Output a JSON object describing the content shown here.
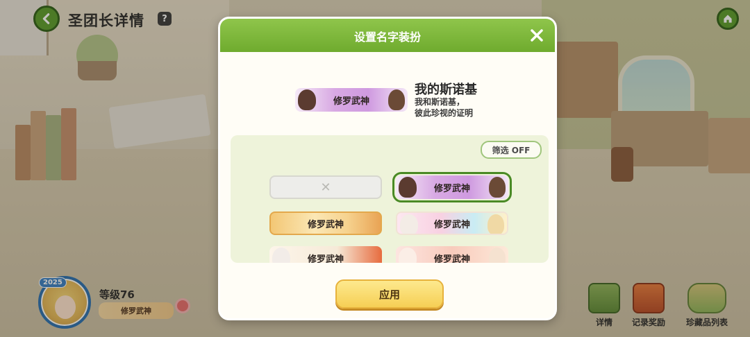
{
  "header": {
    "title": "圣团长详情",
    "help_label": "?"
  },
  "player": {
    "year_badge": "2025",
    "level": "等级76",
    "nameplate": "修罗武神"
  },
  "bottom_nav": [
    {
      "label": "详情",
      "icon": "book-icon"
    },
    {
      "label": "记录奖励",
      "icon": "treasure-chest-icon"
    },
    {
      "label": "珍藏品列表",
      "icon": "collection-icon"
    }
  ],
  "dialog": {
    "title": "设置名字装扮",
    "close_icon": "close-icon",
    "preview": {
      "nameplate": "修罗武神",
      "name": "我的斯诺基",
      "desc_line1": "我和斯诺基，",
      "desc_line2": "彼此珍视的证明"
    },
    "filter_label": "筛选 OFF",
    "plates": [
      {
        "kind": "none",
        "text": "✕"
      },
      {
        "kind": "purple",
        "text": "修罗武神",
        "selected": true
      },
      {
        "kind": "gold",
        "text": "修罗武神"
      },
      {
        "kind": "pastel",
        "text": "修罗武神"
      },
      {
        "kind": "red",
        "text": "修罗武神"
      },
      {
        "kind": "peach",
        "text": "修罗武神"
      }
    ],
    "apply_label": "应用"
  },
  "colors": {
    "accent_green": "#6fab2e",
    "button_yellow": "#f6cf55",
    "selected_outline": "#4a8a25"
  }
}
